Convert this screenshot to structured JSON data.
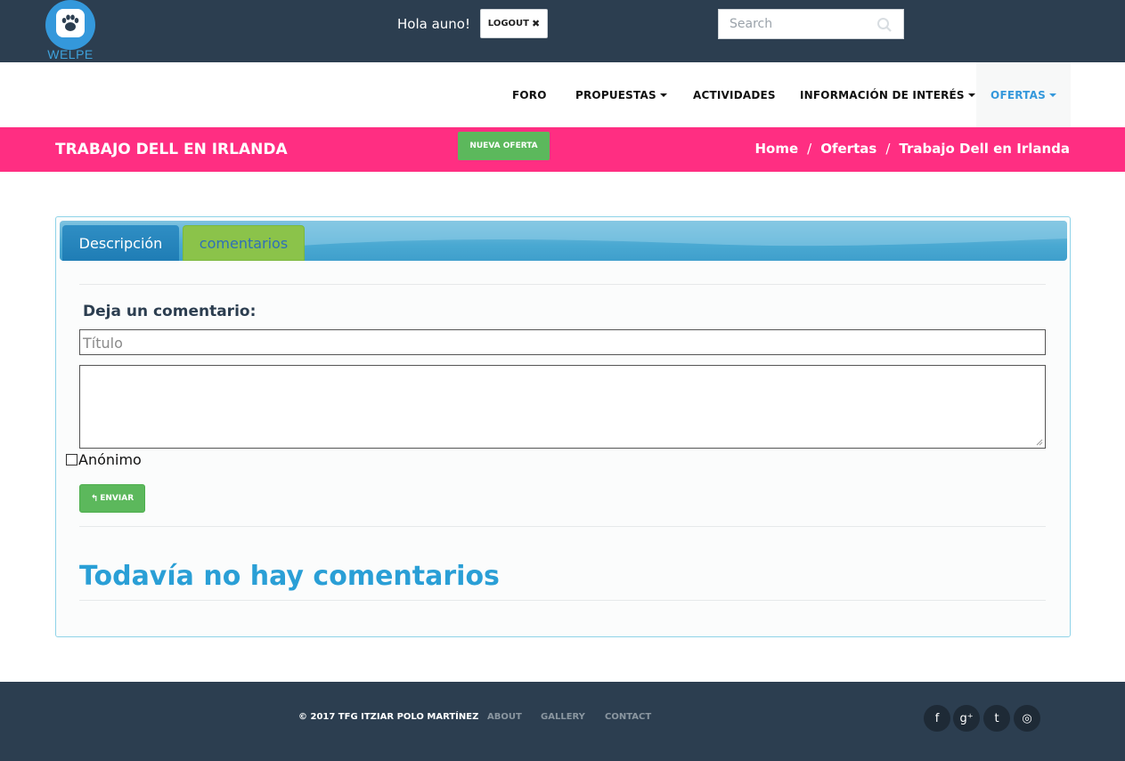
{
  "header": {
    "logo_text": "WELPE",
    "greeting": "Hola auno!",
    "logout_label": "LOGOUT",
    "logout_icon": "close-icon",
    "search_placeholder": "Search",
    "search_icon": "search-icon"
  },
  "nav": {
    "items": [
      {
        "label": "FORO",
        "dropdown": false
      },
      {
        "label": "PROPUESTAS",
        "dropdown": true
      },
      {
        "label": "ACTIVIDADES",
        "dropdown": false
      },
      {
        "label": "INFORMACIÓN DE INTERÉS",
        "dropdown": true
      },
      {
        "label": "OFERTAS",
        "dropdown": true,
        "active": true
      }
    ]
  },
  "banner": {
    "title": "TRABAJO DELL EN IRLANDA",
    "new_offer_label": "NUEVA OFERTA",
    "breadcrumb": [
      "Home",
      "Ofertas",
      "Trabajo Dell en Irlanda"
    ],
    "separator": "/"
  },
  "panel": {
    "tabs": [
      {
        "label": "Descripción",
        "active": false
      },
      {
        "label": "comentarios",
        "active": true
      }
    ],
    "form": {
      "heading": "Deja un comentario:",
      "title_placeholder": "Título",
      "body_value": "",
      "anonymous_label": "Anónimo",
      "anonymous_checked": false,
      "submit_label": "ENVIAR",
      "submit_icon": "reply-icon"
    },
    "empty_message": "Todavía no hay comentarios"
  },
  "footer": {
    "copyright": "© 2017 TFG ITZIAR POLO MARTÍNEZ",
    "links": [
      "ABOUT",
      "GALLERY",
      "CONTACT"
    ],
    "social": [
      {
        "icon": "facebook-icon",
        "glyph": "f"
      },
      {
        "icon": "google-plus-icon",
        "glyph": "g⁺"
      },
      {
        "icon": "twitter-icon",
        "glyph": "t"
      },
      {
        "icon": "dribbble-icon",
        "glyph": "◎"
      }
    ]
  },
  "colors": {
    "topbar": "#2c3e50",
    "accent_pink": "#ff2e82",
    "green_button": "#5cb85c",
    "link_blue": "#3498db",
    "heading_blue": "#2a9fd6"
  }
}
